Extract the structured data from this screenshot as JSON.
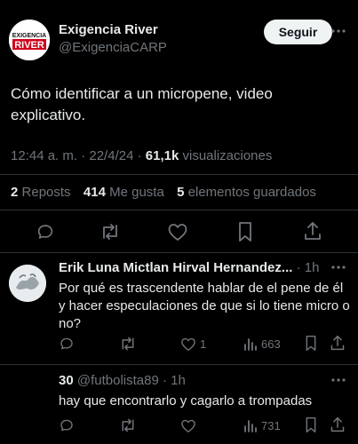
{
  "account": {
    "display_name": "Exigencia River",
    "handle": "@ExigenciaCARP",
    "avatar_text_1": "EXIGENCIA",
    "avatar_text_2": "RIVER",
    "follow_label": "Seguir"
  },
  "tweet": {
    "text": "Cómo identificar a un micropene, video explicativo.",
    "time": "12:44 a. m. · 22/4/24 ·",
    "views_count": "61,1k",
    "views_label": "visualizaciones",
    "reposts_count": "2",
    "reposts_label": "Reposts",
    "likes_count": "414",
    "likes_label": "Me gusta",
    "saved_count": "5",
    "saved_label": "elementos guardados"
  },
  "replies": [
    {
      "name": "Erik Luna Mictlan Hirval Hernandez...",
      "time": "· 1h",
      "text": "Por qué es trascendente hablar de el pene de él y hacer especulaciones de que si lo tiene micro o no?",
      "likes": "1",
      "views": "663"
    },
    {
      "name": "30",
      "handle_time": "@futbolista89 · 1h",
      "text": "hay que encontrarlo y cagarlo a trompadas",
      "views": "731"
    }
  ],
  "colors": {
    "background": "#000000",
    "text": "#e7e9ea",
    "muted": "#71767b",
    "divider": "#2f3336",
    "brand_red": "#d0021b"
  },
  "icons": [
    "more-icon",
    "reply-icon",
    "repost-icon",
    "like-icon",
    "bookmark-icon",
    "share-icon",
    "views-icon"
  ]
}
